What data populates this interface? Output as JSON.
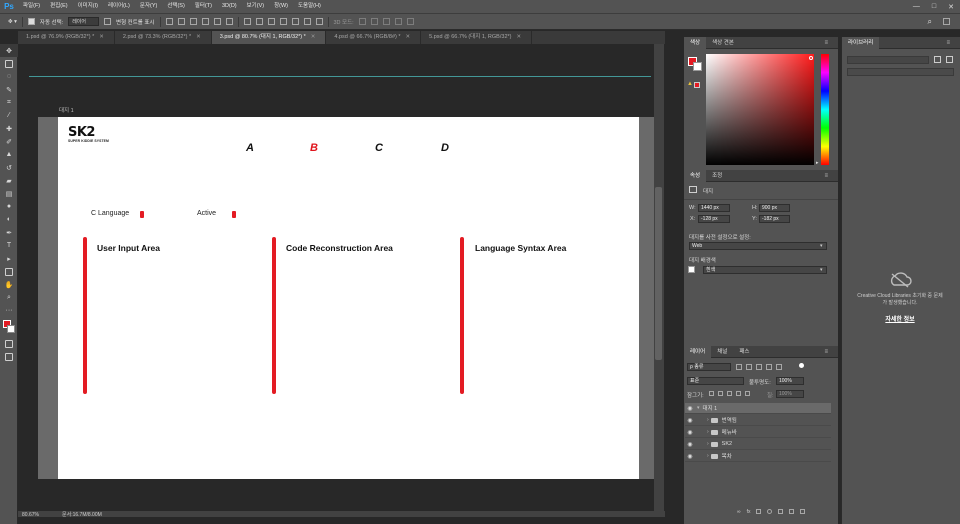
{
  "app": {
    "logo": "Ps"
  },
  "menu": [
    "파일(F)",
    "편집(E)",
    "이미지(I)",
    "레이어(L)",
    "문자(Y)",
    "선택(S)",
    "필터(T)",
    "3D(D)",
    "보기(V)",
    "창(W)",
    "도움말(H)"
  ],
  "window_controls": {
    "minimize": "—",
    "maximize": "□",
    "close": "✕"
  },
  "options": {
    "auto_select_label": "자동 선택:",
    "auto_select_value": "레이어",
    "transform_label": "변형 컨트롤 표시",
    "mode_3d_label": "3D 모드:"
  },
  "tabs": [
    {
      "label": "1.psd @ 76.9% (RGB/32*) *",
      "active": false
    },
    {
      "label": "2.psd @ 73.3% (RGB/32*) *",
      "active": false
    },
    {
      "label": "3.psd @ 80.7% (대지 1, RGB/32*) *",
      "active": true
    },
    {
      "label": "4.psd @ 66.7% (RGB/8#) *",
      "active": false
    },
    {
      "label": "5.psd @ 66.7% (대지 1, RGB/32*)",
      "active": false
    }
  ],
  "canvas": {
    "artboard_label": "대지 1",
    "logo": "SK2",
    "logo_tagline": "SUPER KIDDIE SYSTEM",
    "nav": [
      "A",
      "B",
      "C",
      "D"
    ],
    "nav_active_index": 1,
    "language_label": "C Language",
    "active_label": "Active",
    "columns": [
      "User Input Area",
      "Code Reconstruction Area",
      "Language Syntax Area"
    ]
  },
  "status": {
    "zoom": "80.67%",
    "doc": "문서:16.7M/8.00M"
  },
  "color_panel": {
    "tabs": [
      "색상",
      "색상 견본"
    ],
    "fg": "#e31b23",
    "bg": "#ffffff"
  },
  "properties_panel": {
    "tabs": [
      "속성",
      "조정"
    ],
    "type": "대지",
    "w_label": "W:",
    "w_value": "1440 px",
    "h_label": "H:",
    "h_value": "900 px",
    "x_label": "X:",
    "x_value": "-128 px",
    "y_label": "Y:",
    "y_value": "-182 px",
    "preset_label": "대지를 사전 설정으로 설정:",
    "preset_value": "Web",
    "bgcolor_label": "대지 배경색",
    "bgcolor_value": "흰색"
  },
  "layers_panel": {
    "tabs": [
      "레이어",
      "채널",
      "패스"
    ],
    "filter_value": "ρ 종류",
    "blend_mode": "표준",
    "opacity_label": "불투명도:",
    "opacity_value": "100%",
    "lock_label": "잠그기:",
    "fill_label": "칠:",
    "fill_value": "100%",
    "layers": [
      {
        "name": "대지 1",
        "type": "artboard",
        "selected": true
      },
      {
        "name": "번역됨",
        "type": "folder",
        "selected": false
      },
      {
        "name": "메뉴바",
        "type": "folder",
        "selected": false
      },
      {
        "name": "SK2",
        "type": "folder",
        "selected": false
      },
      {
        "name": "목차",
        "type": "folder",
        "selected": false
      }
    ]
  },
  "libraries_panel": {
    "tab": "라이브러리",
    "message_line1": "Creative Cloud Libraries 초기화 중 문제",
    "message_line2": "가 발생했습니다.",
    "link": "자세한 정보"
  }
}
